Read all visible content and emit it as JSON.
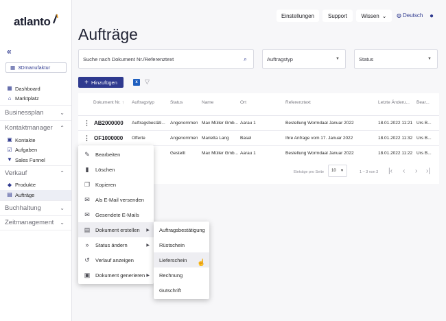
{
  "brand": {
    "name": "atlanto"
  },
  "sidebar": {
    "company": "3Dmanufaktur",
    "items_top": [
      {
        "label": "Dashboard",
        "icon": "dashboard-icon"
      },
      {
        "label": "Marktplatz",
        "icon": "store-icon"
      }
    ],
    "sections": [
      {
        "label": "Businessplan",
        "expanded": false,
        "items": []
      },
      {
        "label": "Kontaktmanager",
        "expanded": true,
        "items": [
          "Kontakte",
          "Aufgaben",
          "Sales Funnel"
        ]
      },
      {
        "label": "Verkauf",
        "expanded": true,
        "items": [
          "Produkte",
          "Aufträge"
        ]
      },
      {
        "label": "Buchhaltung",
        "expanded": false,
        "items": []
      },
      {
        "label": "Zeitmanagement",
        "expanded": false,
        "items": []
      }
    ]
  },
  "topbar": {
    "settings": "Einstellungen",
    "support": "Support",
    "knowledge": "Wissen",
    "language": "Deutsch"
  },
  "page": {
    "title": "Aufträge"
  },
  "filters": {
    "search_placeholder": "Suche nach Dokument Nr./Referenztext",
    "type": "Auftragstyp",
    "status": "Status"
  },
  "toolbar": {
    "add": "Hinzufügen"
  },
  "table": {
    "headers": [
      "Dokument Nr.",
      "Auftragstyp",
      "Status",
      "Name",
      "Ort",
      "Referenztext",
      "Letzte Änderu...",
      "Bear..."
    ],
    "rows": [
      [
        "AB2000000",
        "Auftragsbestäti...",
        "Angenommen",
        "Max Müller Gmb...",
        "Aarau 1",
        "Bestellung Wormdaal Januar 2022",
        "18.01.2022 11:21",
        "Urs B..."
      ],
      [
        "OF1000000",
        "Offerte",
        "Angenommen",
        "Marietta Lang",
        "Basel",
        "Ihre Anfrage vom 17. Januar 2022",
        "18.01.2022 11:32",
        "Urs B..."
      ],
      [
        "",
        "",
        "Gestellt",
        "Max Müller Gmb...",
        "Aarau 1",
        "Bestellung Wormdaal Januar 2022",
        "18.01.2022 11:22",
        "Urs B..."
      ]
    ],
    "per_page_label": "Einträge pro Seite",
    "per_page": "10",
    "range": "1 – 3 von 3"
  },
  "context_menu": [
    {
      "label": "Bearbeiten",
      "icon": "pencil-icon",
      "submenu": false
    },
    {
      "label": "Löschen",
      "icon": "trash-icon",
      "submenu": false
    },
    {
      "label": "Kopieren",
      "icon": "copy-icon",
      "submenu": false
    },
    {
      "label": "Als E-Mail versenden",
      "icon": "mail-icon",
      "submenu": false
    },
    {
      "label": "Gesendete E-Mails",
      "icon": "mail-sent-icon",
      "submenu": false
    },
    {
      "label": "Dokument erstellen",
      "icon": "document-icon",
      "submenu": true
    },
    {
      "label": "Status ändern",
      "icon": "double-chevron-icon",
      "submenu": true
    },
    {
      "label": "Verlauf anzeigen",
      "icon": "history-icon",
      "submenu": false
    },
    {
      "label": "Dokument generieren",
      "icon": "document-generate-icon",
      "submenu": true
    }
  ],
  "submenu": [
    "Auftragsbestätigung",
    "Rüstschein",
    "Lieferschein",
    "Rechnung",
    "Gutschrift"
  ],
  "colors": {
    "primary": "#2f3a8f",
    "background": "#f7f7f9",
    "sidebar": "#ffffff"
  }
}
